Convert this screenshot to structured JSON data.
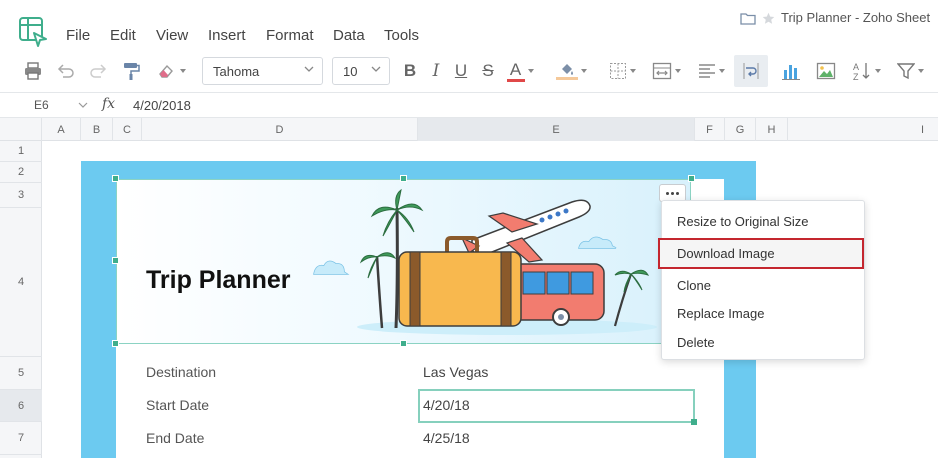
{
  "app": {
    "title": "Trip Planner - Zoho Sheet",
    "logo": "zoho-sheet-logo"
  },
  "menu": {
    "file": "File",
    "edit": "Edit",
    "view": "View",
    "insert": "Insert",
    "format": "Format",
    "data": "Data",
    "tools": "Tools"
  },
  "toolbar": {
    "font_family": "Tahoma",
    "font_size": "10",
    "bold": "B",
    "italic": "I",
    "underline": "U",
    "strike": "S",
    "font_color": "A",
    "font_color_swatch": "#e04848",
    "fill_color_swatch": "#f5c99a",
    "icons": [
      "print-icon",
      "undo-icon",
      "redo-icon",
      "format-painter-icon",
      "clear-format-icon",
      "fill-color-icon",
      "borders-icon",
      "merge-icon",
      "align-icon",
      "wrap-icon",
      "chart-icon",
      "image-icon",
      "sort-icon",
      "filter-icon"
    ]
  },
  "formula_bar": {
    "cell_ref": "E6",
    "fx": "fx",
    "value": "4/20/2018"
  },
  "grid": {
    "columns": [
      "A",
      "B",
      "C",
      "D",
      "E",
      "F",
      "G",
      "H",
      "I"
    ],
    "rows": [
      "1",
      "2",
      "3",
      "4",
      "5",
      "6",
      "7"
    ],
    "selected_column": "E",
    "selected_row": "6"
  },
  "sheet": {
    "banner_title": "Trip Planner",
    "fields": [
      {
        "label": "Destination",
        "value": "Las Vegas"
      },
      {
        "label": "Start Date",
        "value": "4/20/18"
      },
      {
        "label": "End Date",
        "value": "4/25/18"
      }
    ],
    "frame_color": "#6ccaf0",
    "selection_color": "#3fae8c"
  },
  "context_menu": {
    "items": [
      {
        "label": "Resize to Original Size"
      },
      {
        "label": "Download Image"
      },
      {
        "label": "Clone"
      },
      {
        "label": "Replace Image"
      },
      {
        "label": "Delete"
      }
    ],
    "highlighted": "Download Image",
    "highlight_color": "#c4262e"
  }
}
